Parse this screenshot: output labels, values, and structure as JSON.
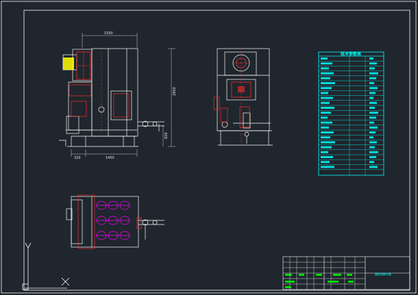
{
  "colors": {
    "background": "#1f262d",
    "outline": "#ffffff",
    "accent_red": "#ff2a2a",
    "accent_cyan": "#00ffff",
    "accent_magenta": "#ff00ff",
    "accent_yellow": "#ffff00",
    "accent_green": "#00ff00"
  },
  "front_view": {
    "dim_top": "1550",
    "dim_right": "2850",
    "dim_right_lower": "820",
    "dim_bottom_left": "320",
    "dim_bottom_mid": "1450"
  },
  "parameter_table": {
    "title": "技术参数表"
  },
  "title_block": {
    "drawing_name": "圆盘溶解设备"
  },
  "ucs": {
    "y_label": "Y",
    "x_label": "X"
  }
}
